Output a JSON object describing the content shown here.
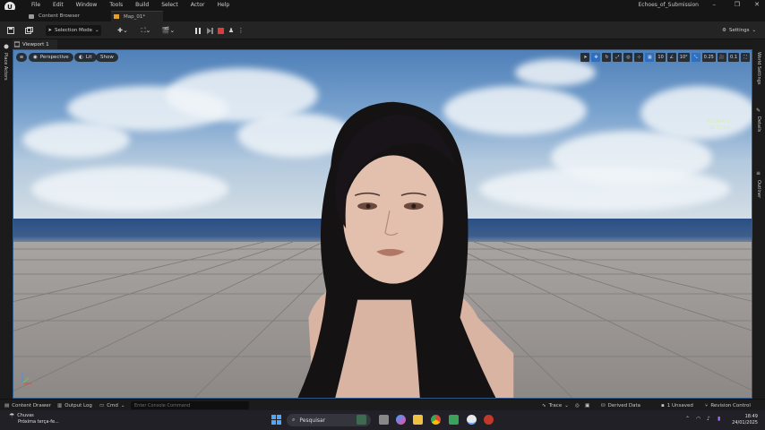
{
  "menu": [
    "File",
    "Edit",
    "Window",
    "Tools",
    "Build",
    "Select",
    "Actor",
    "Help"
  ],
  "project_name": "Echoes_of_Submission",
  "window_controls": {
    "minimize": "–",
    "maximize": "❐",
    "close": "✕"
  },
  "tabs": {
    "content_browser": "Content Browser",
    "map": "Map_01*"
  },
  "toolbar": {
    "selection_mode": "Selection Mode",
    "settings": "Settings"
  },
  "left_panel": {
    "place_actors": "Place Actors"
  },
  "right_panel": {
    "world_settings": "World Settings",
    "details": "Details",
    "outliner": "Outliner"
  },
  "viewport": {
    "tab_label": "Viewport 1",
    "perspective": "Perspective",
    "lit": "Lit",
    "show": "Show",
    "grid_value": "10",
    "angle_value": "10°",
    "scale_value": "0.25",
    "speed_value": "0.1",
    "fps_line1": "60.36 FPS",
    "fps_line2": "16.57 ms"
  },
  "bottombar": {
    "content_drawer": "Content Drawer",
    "output_log": "Output Log",
    "cmd": "Cmd",
    "console_placeholder": "Enter Console Command",
    "trace": "Trace",
    "derived_data": "Derived Data",
    "unsaved": "1 Unsaved",
    "revision_control": "Revision Control"
  },
  "taskbar": {
    "weather_title": "Chuvas",
    "weather_sub": "Próxima terça-fe...",
    "search": "Pesquisar",
    "time": "18:49",
    "date": "24/01/2025"
  },
  "colors": {
    "accent_blue": "#2f6fbf",
    "record_red": "#e03b3b",
    "viewport_border": "#2d5a8a"
  }
}
